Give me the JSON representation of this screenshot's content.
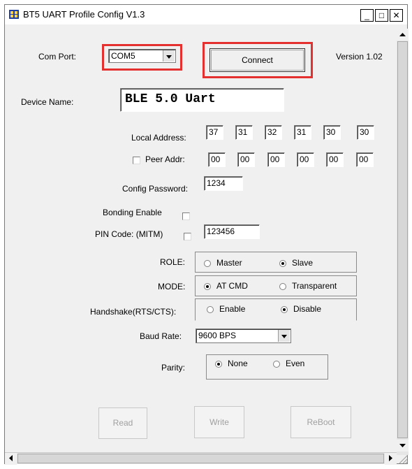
{
  "window": {
    "title": "BT5 UART Profile Config V1.3"
  },
  "titlebar_buttons": {
    "minimize": "_",
    "maximize": "□",
    "close": "✕"
  },
  "com_port": {
    "label": "Com Port:",
    "value": "COM5"
  },
  "connect_button": "Connect",
  "version": "Version  1.02",
  "device_name": {
    "label": "Device Name:",
    "value": "BLE 5.0 Uart"
  },
  "local_address": {
    "label": "Local Address:",
    "bytes": [
      "37",
      "31",
      "32",
      "31",
      "30",
      "30"
    ]
  },
  "peer_address": {
    "label": "Peer Addr:",
    "checked": false,
    "bytes": [
      "00",
      "00",
      "00",
      "00",
      "00",
      "00"
    ]
  },
  "config_password": {
    "label": "Config Password:",
    "value": "1234"
  },
  "bonding_enable": {
    "label": "Bonding Enable",
    "checked": false
  },
  "pin_code": {
    "label": "PIN Code: (MITM)",
    "checked": false,
    "value": "123456"
  },
  "role": {
    "label": "ROLE:",
    "options": [
      "Master",
      "Slave"
    ],
    "selected": "Slave"
  },
  "mode": {
    "label": "MODE:",
    "options": [
      "AT CMD",
      "Transparent"
    ],
    "selected": "AT CMD"
  },
  "handshake": {
    "label": "Handshake(RTS/CTS):",
    "options": [
      "Enable",
      "Disable"
    ],
    "selected": "Disable"
  },
  "baud_rate": {
    "label": "Baud Rate:",
    "value": "9600 BPS"
  },
  "parity": {
    "label": "Parity:",
    "options": [
      "None",
      "Even"
    ],
    "selected": "None"
  },
  "actions": {
    "read": "Read",
    "write": "Write",
    "reboot": "ReBoot"
  },
  "highlight_color": "#e53030"
}
